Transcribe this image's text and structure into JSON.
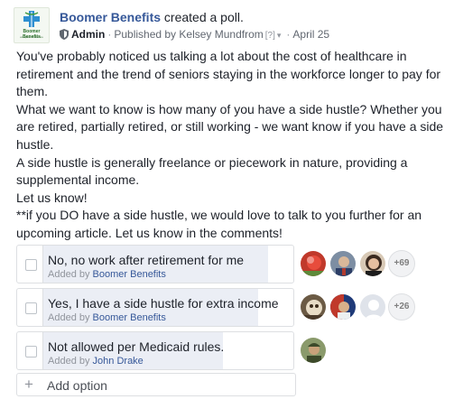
{
  "header": {
    "page_name": "Boomer Benefits",
    "action": "created a poll.",
    "logo_text": "Boomer Benefits",
    "logo_subtext": "we speak medicare",
    "role": "Admin",
    "published_by": "Published by Kelsey Mundfrom",
    "tag": "[?]",
    "date": "April 25"
  },
  "post": {
    "paragraphs": [
      "You've probably noticed us talking a lot about the cost of healthcare in retirement and the trend of seniors staying in the workforce longer to pay for them.",
      "What we want to know is how many of you have a side hustle? Whether you are retired, partially retired, or still working - we want know if you have a side hustle.",
      "A side hustle is generally freelance or piecework in nature, providing a supplemental income.",
      "Let us know!",
      "**if you DO have a side hustle, we would love to talk to you further for an upcoming article. Let us know in the comments!"
    ]
  },
  "poll": {
    "options": [
      {
        "label": "No, no work after retirement for me",
        "added_prefix": "Added by",
        "added_by": "Boomer Benefits",
        "more_voters": "+69",
        "vote_share": 0.9
      },
      {
        "label": "Yes, I have a side hustle for extra income",
        "added_prefix": "Added by",
        "added_by": "Boomer Benefits",
        "more_voters": "+26",
        "vote_share": 0.86
      },
      {
        "label": "Not allowed per Medicaid rules.",
        "added_prefix": "Added by",
        "added_by": "John Drake",
        "more_voters": "",
        "vote_share": 0.72
      }
    ],
    "add_option_label": "Add option"
  },
  "colors": {
    "link": "#365899",
    "fill": "#ebeef5",
    "border": "#dddfe2",
    "meta": "#616770"
  }
}
